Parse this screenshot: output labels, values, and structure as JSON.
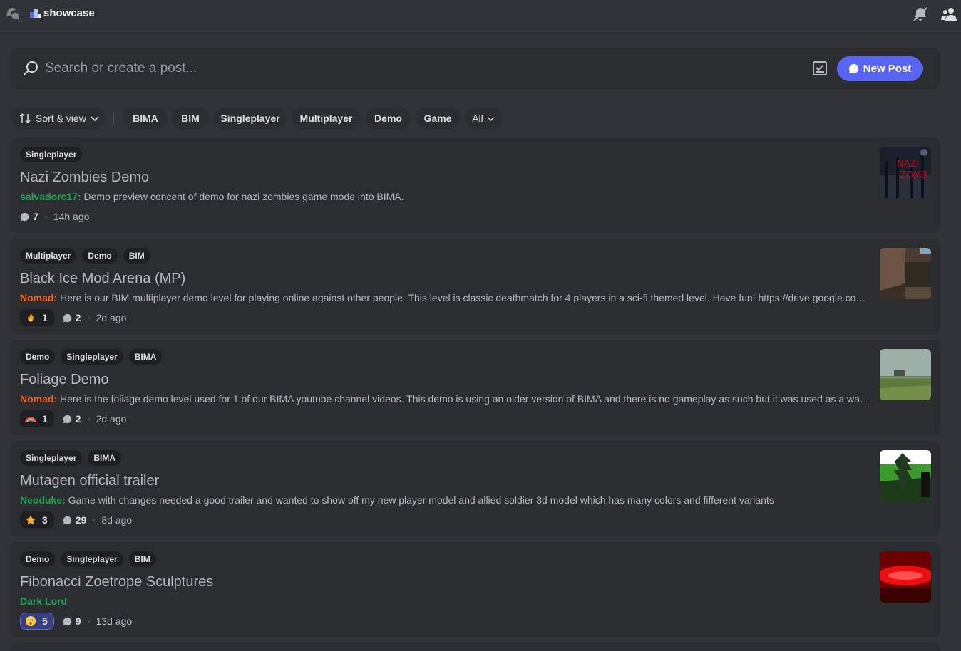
{
  "channel": {
    "name": "showcase"
  },
  "search": {
    "placeholder": "Search or create a post..."
  },
  "new_post_label": "New Post",
  "filters": {
    "sort_label": "Sort & view",
    "tags": [
      "BIMA",
      "BIM",
      "Singleplayer",
      "Multiplayer",
      "Demo",
      "Game"
    ],
    "all_label": "All"
  },
  "colors": {
    "accent": "#5865f2",
    "author_green": "#23a55a",
    "author_orange": "#f0b232",
    "author_red": "#f26522"
  },
  "posts": [
    {
      "tags": [
        "Singleplayer"
      ],
      "title": "Nazi Zombies Demo",
      "author": "salvadorc17",
      "author_color": "#23a55a",
      "message": "Demo preview concent of demo for nazi zombies game mode into BIMA.",
      "reaction": null,
      "comments": "7",
      "time": "14h ago",
      "thumb": "dark-blue-red-text"
    },
    {
      "tags": [
        "Multiplayer",
        "Demo",
        "BIM"
      ],
      "title": "Black Ice Mod Arena (MP)",
      "author": "Nomad",
      "author_color": "#f26522",
      "message": "Here is our BIM multiplayer demo level for playing online against other people. This level is classic deathmatch for 4 players in a sci-fi themed level. Have fun! https://drive.google.com/file/d...",
      "reaction": {
        "emoji": "fire-emoji",
        "count": "1",
        "active": false
      },
      "comments": "2",
      "time": "2d ago",
      "thumb": "brown-corridor"
    },
    {
      "tags": [
        "Demo",
        "Singleplayer",
        "BIMA"
      ],
      "title": "Foliage Demo",
      "author": "Nomad",
      "author_color": "#f26522",
      "message": "Here is the foliage demo level used for 1 of our BIMA youtube channel videos. This demo is using an older version of BIMA and there is no gameplay as such but it was used as a way of testin...",
      "reaction": {
        "emoji": "rainbow-emoji",
        "count": "1",
        "active": false
      },
      "comments": "2",
      "time": "2d ago",
      "thumb": "grass-field"
    },
    {
      "tags": [
        "Singleplayer",
        "BIMA"
      ],
      "title": "Mutagen official trailer",
      "author": "Neoduke",
      "author_color": "#23a55a",
      "message": "Game with changes needed a good trailer and wanted to show off my new player model and allied soldier 3d model which has many colors and fifferent variants",
      "reaction": {
        "emoji": "star-emoji",
        "count": "3",
        "active": false
      },
      "comments": "29",
      "time": "8d ago",
      "thumb": "green-tree"
    },
    {
      "tags": [
        "Demo",
        "Singleplayer",
        "BIM"
      ],
      "title": "Fibonacci Zoetrope Sculptures",
      "author": "Dark Lord",
      "author_color": "#23a55a",
      "message": "",
      "reaction": {
        "emoji": "astonished-emoji",
        "count": "5",
        "active": true
      },
      "comments": "9",
      "time": "13d ago",
      "thumb": "red-glow"
    }
  ]
}
